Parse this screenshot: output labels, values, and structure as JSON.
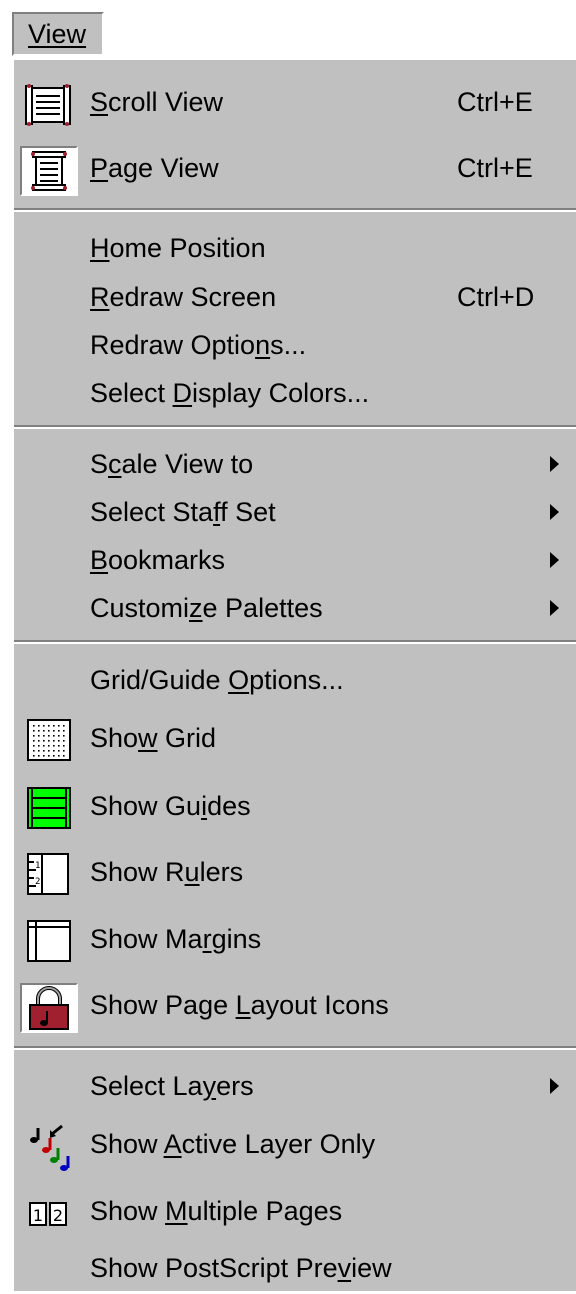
{
  "menubar": {
    "title": "View"
  },
  "menu": {
    "scroll_view": {
      "label_pre": "",
      "label_u": "S",
      "label_post": "croll View",
      "shortcut": "Ctrl+E"
    },
    "page_view": {
      "label_pre": "",
      "label_u": "P",
      "label_post": "age View",
      "shortcut": "Ctrl+E"
    },
    "home_position": {
      "label_pre": "",
      "label_u": "H",
      "label_post": "ome Position"
    },
    "redraw_screen": {
      "label_pre": "",
      "label_u": "R",
      "label_post": "edraw Screen",
      "shortcut": "Ctrl+D"
    },
    "redraw_options": {
      "label_pre": "Redraw Optio",
      "label_u": "n",
      "label_post": "s..."
    },
    "select_display_colors": {
      "label_pre": "Select ",
      "label_u": "D",
      "label_post": "isplay Colors..."
    },
    "scale_view_to": {
      "label_pre": "S",
      "label_u": "c",
      "label_post": "ale View to"
    },
    "select_staff_set": {
      "label_pre": "Select Sta",
      "label_u": "f",
      "label_post": "f Set"
    },
    "bookmarks": {
      "label_pre": "",
      "label_u": "B",
      "label_post": "ookmarks"
    },
    "customize_palettes": {
      "label_pre": "Customi",
      "label_u": "z",
      "label_post": "e Palettes"
    },
    "grid_guide_options": {
      "label_pre": "Grid/Guide ",
      "label_u": "O",
      "label_post": "ptions..."
    },
    "show_grid": {
      "label_pre": "Sho",
      "label_u": "w",
      "label_post": " Grid"
    },
    "show_guides": {
      "label_pre": "Show Gu",
      "label_u": "i",
      "label_post": "des"
    },
    "show_rulers": {
      "label_pre": "Show R",
      "label_u": "u",
      "label_post": "lers"
    },
    "show_margins": {
      "label_pre": "Show Ma",
      "label_u": "r",
      "label_post": "gins"
    },
    "show_page_layout_icons": {
      "label_pre": "Show Page ",
      "label_u": "L",
      "label_post": "ayout Icons"
    },
    "select_layers": {
      "label_pre": "Select La",
      "label_u": "y",
      "label_post": "ers"
    },
    "show_active_layer_only": {
      "label_pre": "Show ",
      "label_u": "A",
      "label_post": "ctive Layer Only"
    },
    "show_multiple_pages": {
      "label_pre": "Show ",
      "label_u": "M",
      "label_post": "ultiple Pages"
    },
    "show_postscript_preview": {
      "label_pre": "Show PostScript Pre",
      "label_u": "v",
      "label_post": "iew"
    }
  },
  "icons": {
    "scroll_view": "scroll-view-icon",
    "page_view": "page-view-icon",
    "show_grid": "grid-icon",
    "show_guides": "guides-icon",
    "show_rulers": "rulers-icon",
    "show_margins": "margins-icon",
    "show_page_layout_icons": "padlock-icon",
    "show_active_layer_only": "layers-icon",
    "show_multiple_pages": "multiple-pages-icon"
  },
  "colors": {
    "menu_bg": "#c0c0c0",
    "separator_dark": "#808080",
    "separator_light": "#ffffff",
    "guides_green": "#00ff00",
    "padlock_red": "#a02030"
  }
}
